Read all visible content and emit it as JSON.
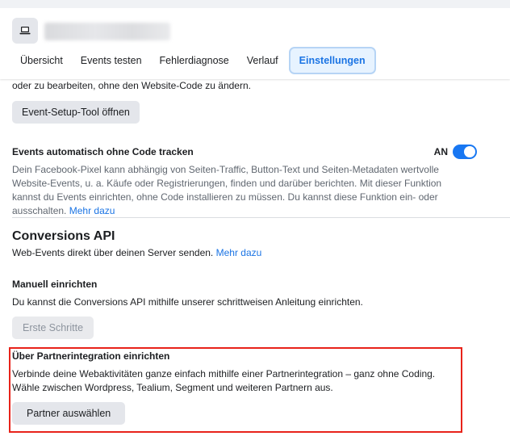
{
  "header": {
    "tabs": [
      {
        "label": "Übersicht"
      },
      {
        "label": "Events testen"
      },
      {
        "label": "Fehlerdiagnose"
      },
      {
        "label": "Verlauf"
      },
      {
        "label": "Einstellungen",
        "active": true
      }
    ]
  },
  "event_setup": {
    "description_tail": "oder zu bearbeiten, ohne den Website-Code zu ändern.",
    "button_label": "Event-Setup-Tool öffnen"
  },
  "auto_tracking": {
    "title": "Events automatisch ohne Code tracken",
    "toggle_label": "AN",
    "description": "Dein Facebook-Pixel kann abhängig von Seiten-Traffic, Button-Text und Seiten-Metadaten wertvolle Website-Events, u. a. Käufe oder Registrierungen, finden und darüber berichten. Mit dieser Funktion kannst du Events einrichten, ohne Code installieren zu müssen. Du kannst diese Funktion ein- oder ausschalten.",
    "link": "Mehr dazu"
  },
  "conversions_api": {
    "title": "Conversions API",
    "description": "Web-Events direkt über deinen Server senden.",
    "link": "Mehr dazu",
    "manual": {
      "title": "Manuell einrichten",
      "description": "Du kannst die Conversions API mithilfe unserer schrittweisen Anleitung einrichten.",
      "button_label": "Erste Schritte"
    },
    "partner": {
      "title": "Über Partnerintegration einrichten",
      "description": "Verbinde deine Webaktivitäten ganze einfach mithilfe einer Partnerintegration – ganz ohne Coding. Wähle zwischen Wordpress, Tealium, Segment und weiteren Partnern aus.",
      "button_label": "Partner auswählen"
    }
  },
  "colors": {
    "accent": "#1b74e4",
    "highlight": "#e8231a",
    "toggle_on": "#1877f2"
  }
}
